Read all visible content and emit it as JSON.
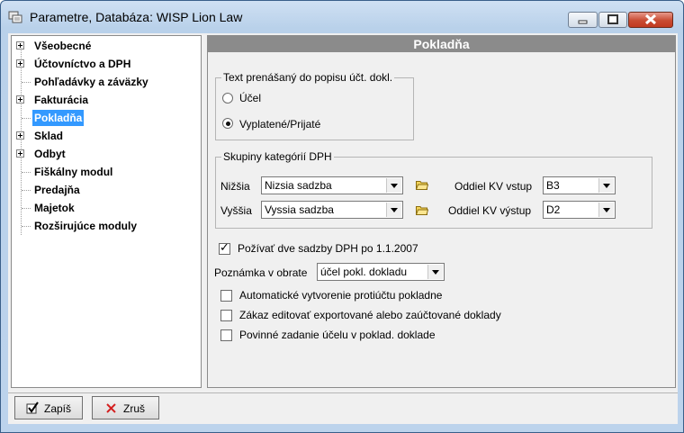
{
  "window": {
    "title": "Parametre,  Databáza: WISP Lion Law"
  },
  "tree": {
    "items": [
      {
        "label": "Všeobecné",
        "expandable": true,
        "selected": false
      },
      {
        "label": "Účtovníctvo a DPH",
        "expandable": true,
        "selected": false
      },
      {
        "label": "Pohľadávky a záväzky",
        "expandable": false,
        "selected": false
      },
      {
        "label": "Fakturácia",
        "expandable": true,
        "selected": false
      },
      {
        "label": "Pokladňa",
        "expandable": false,
        "selected": true
      },
      {
        "label": "Sklad",
        "expandable": true,
        "selected": false
      },
      {
        "label": "Odbyt",
        "expandable": true,
        "selected": false
      },
      {
        "label": "Fiškálny modul",
        "expandable": false,
        "selected": false
      },
      {
        "label": "Predajňa",
        "expandable": false,
        "selected": false
      },
      {
        "label": "Majetok",
        "expandable": false,
        "selected": false
      },
      {
        "label": "Rozširujúce moduly",
        "expandable": false,
        "selected": false
      }
    ]
  },
  "panel": {
    "header": "Pokladňa",
    "text_group": {
      "legend": "Text prenášaný do popisu účt. dokl.",
      "option_ucel": "Účel",
      "option_vyplatene": "Vyplatené/Prijaté",
      "selected": "Vyplatené/Prijaté"
    },
    "dph_group": {
      "legend": "Skupiny kategórií DPH",
      "nizsia_label": "Nižšia",
      "nizsia_value": "Nizsia sadzba",
      "vyssia_label": "Vyššia",
      "vyssia_value": "Vyssia sadzba",
      "kv_vstup_label": "Oddiel KV vstup",
      "kv_vstup_value": "B3",
      "kv_vystup_label": "Oddiel KV výstup",
      "kv_vystup_value": "D2"
    },
    "two_rates": {
      "label": "Požívať dve sadzby DPH po 1.1.2007",
      "checked": true
    },
    "note": {
      "label": "Poznámka v obrate",
      "value": "účel pokl. dokladu"
    },
    "options": [
      {
        "label": "Automatické vytvorenie protiúčtu pokladne",
        "checked": false
      },
      {
        "label": "Zákaz editovať exportované alebo zaúčtované doklady",
        "checked": false
      },
      {
        "label": "Povinné zadanie účelu v poklad. doklade",
        "checked": false
      }
    ]
  },
  "buttons": {
    "save": "Zapíš",
    "cancel": "Zruš"
  },
  "colors": {
    "tree_text": "#000080",
    "selection": "#3399ff",
    "header_bg": "#8b8b8b",
    "cancel_icon": "#d42020"
  },
  "icons": {
    "folder": "folder-icon",
    "save": "checkmark-icon",
    "cancel": "x-icon"
  }
}
